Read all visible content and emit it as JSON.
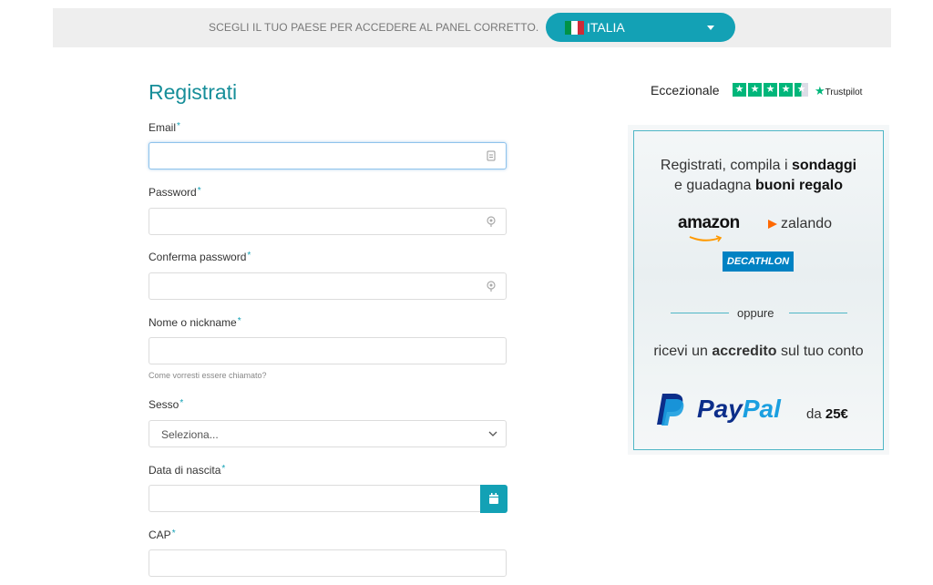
{
  "topbar": {
    "prompt": "SCEGLI IL TUO PAESE PER ACCEDERE AL PANEL CORRETTO.",
    "country": "ITALIA",
    "flag_colors": [
      "#009246",
      "#ffffff",
      "#ce2b37"
    ],
    "accent": "#13a1b5"
  },
  "form": {
    "title": "Registrati",
    "required_mark": "*",
    "email_label": "Email",
    "password_label": "Password",
    "confirm_password_label": "Conferma password",
    "nickname_label": "Nome o nickname",
    "nickname_hint": "Come vorresti essere chiamato?",
    "gender_label": "Sesso",
    "gender_value": "Seleziona...",
    "birthdate_label": "Data di nascita",
    "zip_label": "CAP"
  },
  "trustpilot": {
    "rating_label": "Eccezionale",
    "brand": "Trustpilot",
    "stars": 4.5
  },
  "promo": {
    "headline_1": "Registrati, compila i",
    "headline_bold_1": "sondaggi",
    "headline_2": "e guadagna",
    "headline_bold_2": "buoni regalo",
    "brand_amazon": "amazon",
    "brand_zalando": "zalando",
    "brand_decathlon": "DECATHLON",
    "separator": "oppure",
    "sub_1": "ricevi un",
    "sub_bold": "accredito",
    "sub_2": "sul tuo conto",
    "paypal_pay": "Pay",
    "paypal_pal": "Pal",
    "paypal_da": "da",
    "paypal_amount": "25€"
  }
}
